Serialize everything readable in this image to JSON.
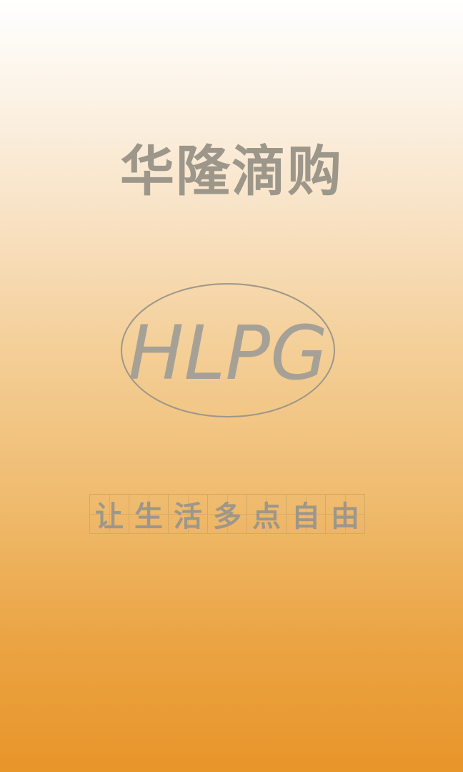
{
  "app": {
    "title": "华隆滴购"
  },
  "logo": {
    "text": "HLPG",
    "icon": "hlpg-ellipse-logo-icon",
    "stroke_color": "#9c978a"
  },
  "slogan": {
    "chars": [
      "让",
      "生",
      "活",
      "多",
      "点",
      "自",
      "由"
    ]
  },
  "colors": {
    "text": "#9c978a",
    "gradient_top": "#ffffff",
    "gradient_bottom": "#e8952a",
    "grid_line": "#d4a86a"
  }
}
